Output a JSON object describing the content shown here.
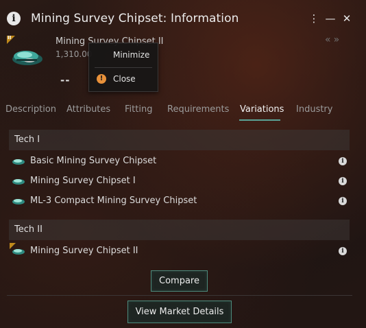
{
  "window": {
    "title": "Mining Survey Chipset: Information",
    "info_icon_glyph": "i",
    "menu_glyph": "⋮",
    "minimize_glyph": "—",
    "close_glyph": "✕"
  },
  "item": {
    "name": "Mining Survey Chipset II",
    "volume": "1,310.00",
    "dashes": "--",
    "tech_badge": "II",
    "nav_arrows": "«»"
  },
  "context_menu": {
    "minimize_label": "Minimize",
    "close_label": "Close",
    "close_icon_glyph": "!"
  },
  "tabs": [
    {
      "label": "Description"
    },
    {
      "label": "Attributes"
    },
    {
      "label": "Fitting"
    },
    {
      "label": "Requirements"
    },
    {
      "label": "Variations"
    },
    {
      "label": "Industry"
    }
  ],
  "active_tab": "Variations",
  "groups": [
    {
      "label": "Tech I",
      "items": [
        {
          "label": "Basic Mining Survey Chipset"
        },
        {
          "label": "Mining Survey Chipset I"
        },
        {
          "label": "ML-3 Compact Mining Survey Chipset"
        }
      ]
    },
    {
      "label": "Tech II",
      "items": [
        {
          "label": "Mining Survey Chipset II",
          "badge": "II"
        }
      ]
    }
  ],
  "info_glyph": "i",
  "buttons": {
    "compare": "Compare",
    "view_market": "View Market Details"
  },
  "colors": {
    "accent": "#5aa396",
    "tech_badge": "#c08a1c",
    "close_icon": "#e8913a"
  }
}
